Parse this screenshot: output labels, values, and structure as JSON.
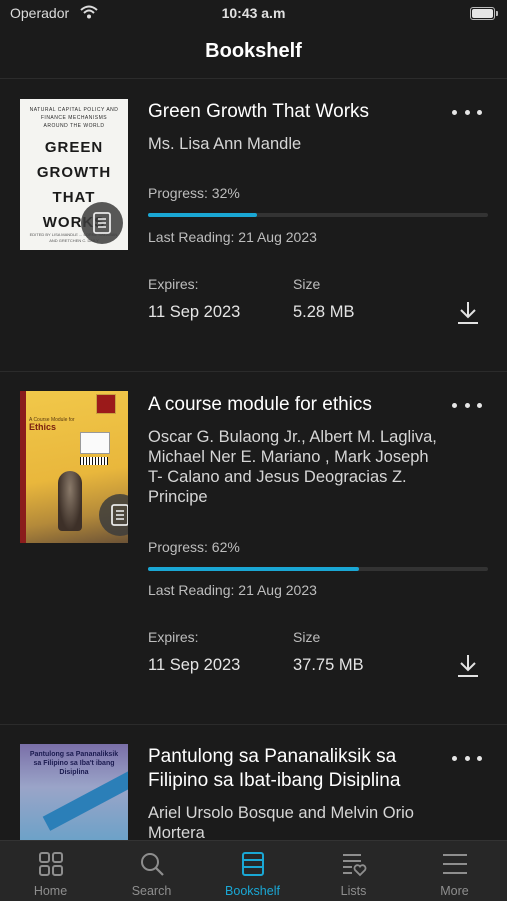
{
  "status_bar": {
    "carrier": "Operador",
    "time": "10:43 a.m"
  },
  "header": {
    "title": "Bookshelf"
  },
  "labels": {
    "progress_prefix": "Progress: ",
    "last_reading_prefix": "Last Reading: ",
    "expires": "Expires:",
    "size": "Size"
  },
  "books": [
    {
      "title": "Green Growth That Works",
      "author": "Ms. Lisa Ann Mandle",
      "progress": 0.32,
      "progress_text": "Progress: 32%",
      "last_reading": "Last Reading: 21 Aug 2023",
      "expires": "11 Sep 2023",
      "size": "5.28 MB",
      "cover": {
        "top_text": "NATURAL CAPITAL POLICY AND FINANCE MECHANISMS AROUND THE WORLD",
        "lines": [
          "GREEN",
          "GROWTH",
          "THAT",
          "WORKS"
        ],
        "bottom_text": "EDITED BY LISA MANDLE ... LORNE SALZMAN, AND GRETCHEN C. DAILY"
      }
    },
    {
      "title": "A course module for ethics",
      "author": "Oscar G. Bulaong Jr., Albert M. Lagliva, Michael Ner E. Mariano , Mark Joseph T- Calano and Jesus Deogracias Z. Principe",
      "progress": 0.62,
      "progress_text": "Progress: 62%",
      "last_reading": "Last Reading: 21 Aug 2023",
      "expires": "11 Sep 2023",
      "size": "37.75 MB",
      "cover": {
        "small_text": "A Course Module for",
        "title": "Ethics"
      }
    },
    {
      "title": "Pantulong sa Pananaliksik sa Filipino sa Ibat-ibang Disiplina",
      "author": "Ariel Ursolo Bosque and Melvin Orio Mortera",
      "cover": {
        "title": "Pantulong sa Pananaliksik sa Filipino sa Iba't ibang Disiplina"
      }
    }
  ],
  "tabs": [
    {
      "label": "Home",
      "icon": "grid-icon"
    },
    {
      "label": "Search",
      "icon": "search-icon"
    },
    {
      "label": "Bookshelf",
      "icon": "bookshelf-icon",
      "active": true
    },
    {
      "label": "Lists",
      "icon": "list-heart-icon"
    },
    {
      "label": "More",
      "icon": "hamburger-icon"
    }
  ],
  "colors": {
    "accent": "#1aa7d4",
    "background": "#1b1b1b",
    "tab_bar": "#272727"
  }
}
